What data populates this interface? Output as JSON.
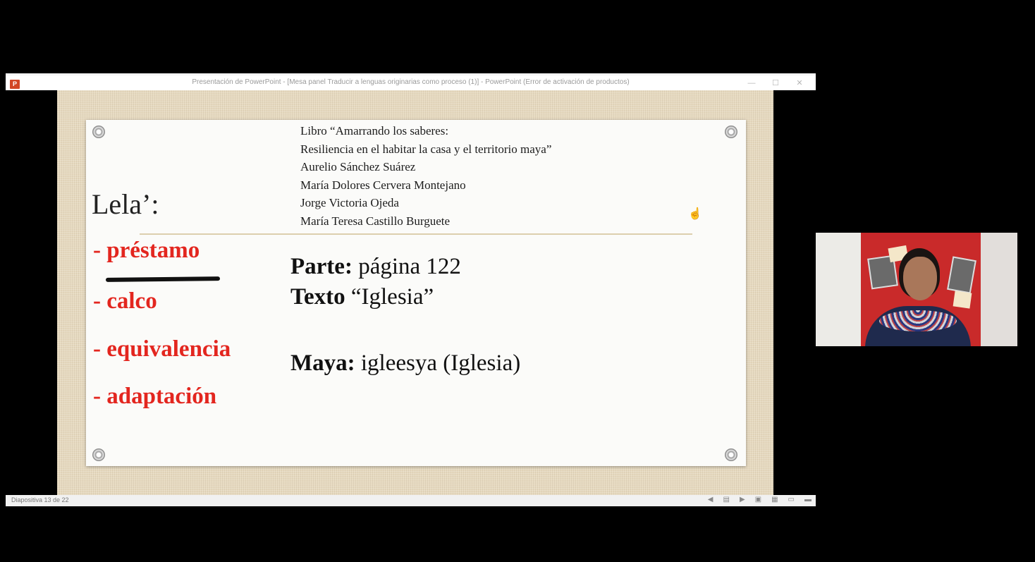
{
  "window": {
    "title": "Presentación de PowerPoint - [Mesa panel Traducir a lenguas originarias como proceso (1)] - PowerPoint (Error de activación de productos)",
    "app_icon": "P",
    "controls": [
      "—",
      "☐",
      "✕"
    ]
  },
  "slide": {
    "credits": [
      "Libro “Amarrando los saberes:",
      "Resiliencia en el habitar la casa y el territorio maya”",
      "Aurelio Sánchez Suárez",
      "María Dolores Cervera Montejano",
      "Jorge Victoria Ojeda",
      "María Teresa Castillo Burguete"
    ],
    "heading": "Lela’:",
    "terms": [
      "- préstamo",
      "- calco",
      "- equivalencia",
      "- adaptación"
    ],
    "details": {
      "parte_label": "Parte:",
      "parte_value": " página 122",
      "texto_label": "Texto",
      "texto_value": " “Iglesia”",
      "maya_label": "Maya:",
      "maya_value": " igleesya (Iglesia)"
    },
    "accent_color": "#e3261f"
  },
  "statusbar": {
    "slide_counter": "Diapositiva 13 de 22",
    "icons": [
      "prev-icon",
      "notes-icon",
      "next-icon",
      "normal-view-icon",
      "slide-sorter-icon",
      "reading-view-icon",
      "slideshow-icon"
    ]
  }
}
